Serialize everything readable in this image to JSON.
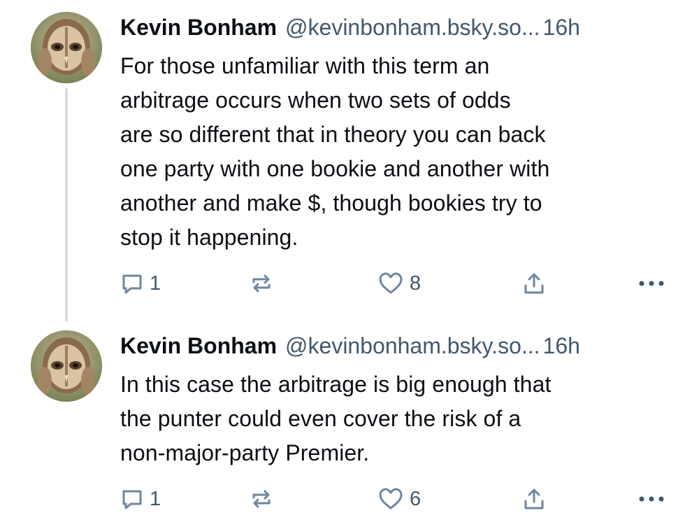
{
  "posts": [
    {
      "author_name": "Kevin Bonham",
      "author_handle": "@kevinbonham.bsky.so...",
      "separator": "",
      "timestamp": "16h",
      "text_lines": [
        "For those unfamiliar with this term an",
        "arbitrage occurs when two sets of odds",
        "are so different that in theory you can back",
        "one party with one bookie and another with",
        "another and make $, though bookies try to",
        "stop it happening."
      ],
      "reply_count": "1",
      "repost_count": "",
      "like_count": "8"
    },
    {
      "author_name": "Kevin Bonham",
      "author_handle": "@kevinbonham.bsky.so...",
      "separator": "",
      "timestamp": "16h",
      "text_lines": [
        "In this case the arbitrage is big enough that",
        "the punter could even cover the risk of a",
        "non-major-party Premier."
      ],
      "reply_count": "1",
      "repost_count": "",
      "like_count": "6"
    }
  ],
  "icons": {
    "reply": "speech-bubble-icon",
    "repost": "repost-arrows-icon",
    "like": "heart-icon",
    "share": "share-upload-icon",
    "more": "more-dots-icon",
    "avatar": "owl-avatar"
  },
  "colors": {
    "text": "#0b0f14",
    "muted": "#42576c",
    "icon": "#6f869f",
    "thread_line": "#d6dde4"
  }
}
